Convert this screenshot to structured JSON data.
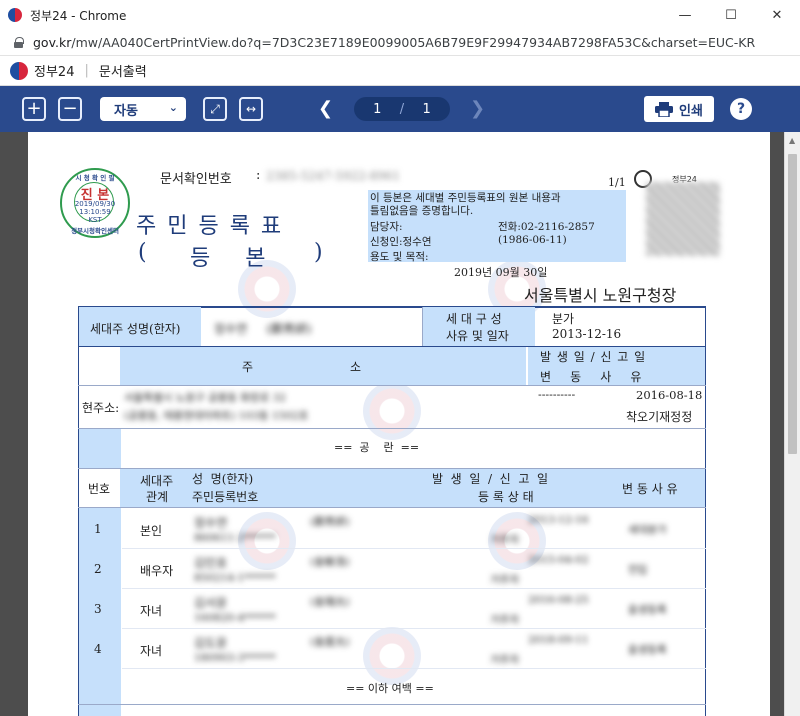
{
  "window": {
    "title": "정부24 - Chrome",
    "url_host": "gov.kr",
    "url_path": "/mw/AA040CertPrintView.do?q=7D3C23E7189E0099005A6B79E9F29947934AB7298FA53C&charset=EUC-KR"
  },
  "site": {
    "brand": "정부24",
    "separator": "|",
    "page_title": "문서출력"
  },
  "toolbar": {
    "zoom_in": "+",
    "zoom_out": "−",
    "zoom_value": "자동",
    "current_page": "1",
    "page_sep": "/",
    "total_pages": "1",
    "print_label": "인쇄",
    "help_label": "?"
  },
  "document": {
    "doc_check_label": "문서확인번호",
    "doc_check_colon": ":",
    "doc_check_number": "2385-5247-5922-8961",
    "page_index": "1/1",
    "gov_mark": "정부24",
    "seal": {
      "top": "시 청 확 인 필",
      "label": "진 본",
      "date": "2019/09/30",
      "time": "13:10:59",
      "tz": "KST",
      "bottom": "정부시청확인센터"
    },
    "title": "주 민 등 록 표",
    "subtitle_left": "(",
    "subtitle_mid": "등     본",
    "subtitle_right": ")",
    "notice_line1": "이 등본은 세대별 주민등록표의 원본 내용과",
    "notice_line2": "틀림없음을 증명합니다.",
    "contact_label": "담당자:",
    "contact_phone": "전화:02-2116-2857",
    "applicant_label": "신청인:정수연",
    "applicant_birth": "(1986-06-11)",
    "purpose_label": "용도 및 목적:",
    "issue_date": "2019년 09월 30일",
    "issuer": "서울특별시 노원구청장",
    "head_label": "세대주 성명(한자)",
    "head_name": "정수연     (鄭秀妍)",
    "household_label_1": "세 대 구 성",
    "household_label_2": "사유 및 일자",
    "household_reason": "분가",
    "household_date": "2013-12-16",
    "address_col_1": "주",
    "address_col_2": "소",
    "occur_header": "발 생 일  /  신 고 일",
    "change_header": "변     동     사     유",
    "current_address_label": "현주소:",
    "current_address_line1": "서울특별시 노원구 공릉동 화랑로 32",
    "current_address_line2": "(공릉동, 태릉현대아파트) 103동 1502호",
    "dashes": "----------",
    "address_date": "2016-08-18",
    "address_reason": "착오기재정정",
    "common_label": "==  공    란  ==",
    "col_no": "번호",
    "col_rel_1": "세대주",
    "col_rel_2": "관계",
    "col_name_1": "성  명(한자)",
    "col_name_2": "주민등록번호",
    "col_occur": "발  생  일  /  신  고  일",
    "col_status": "등 록 상 태",
    "col_reason": "변 동 사 유",
    "members": [
      {
        "no": "1",
        "rel": "본인",
        "name": "정수연",
        "hanja": "(鄭秀妍)",
        "rrn": "860611-2******",
        "date": "2013-12-16",
        "status": "거주자",
        "reason": "세대분가"
      },
      {
        "no": "2",
        "rel": "배우자",
        "name": "김민호",
        "hanja": "(金敏浩)",
        "rrn": "850214-1******",
        "date": "2015-04-02",
        "status": "거주자",
        "reason": "전입"
      },
      {
        "no": "3",
        "rel": "자녀",
        "name": "김서윤",
        "hanja": "(金瑞允)",
        "rrn": "160820-4******",
        "date": "2016-08-25",
        "status": "거주자",
        "reason": "출생등록"
      },
      {
        "no": "4",
        "rel": "자녀",
        "name": "김도윤",
        "hanja": "(金度允)",
        "rrn": "180903-3******",
        "date": "2018-09-11",
        "status": "거주자",
        "reason": "출생등록"
      }
    ],
    "below_blank": "== 이하 여백 =="
  }
}
